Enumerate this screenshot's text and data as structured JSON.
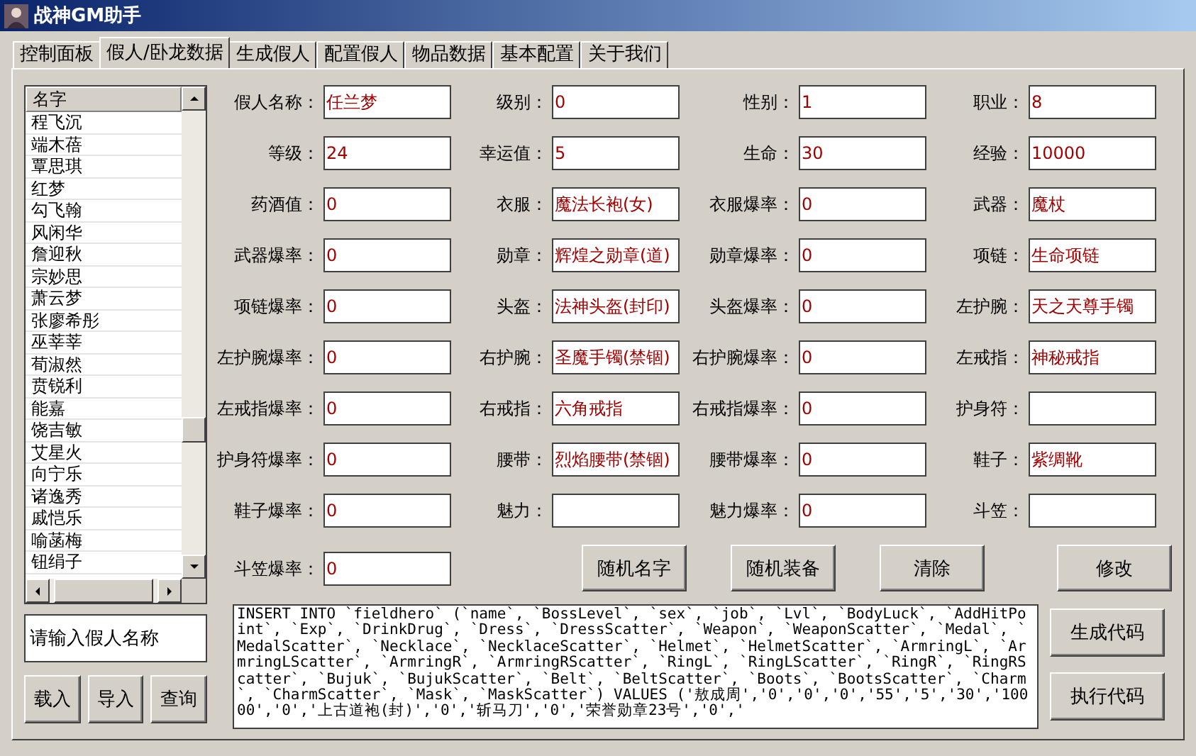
{
  "window": {
    "title": "战神GM助手"
  },
  "tabs": [
    {
      "label": "控制面板",
      "selected": false
    },
    {
      "label": "假人/卧龙数据",
      "selected": true
    },
    {
      "label": "生成假人",
      "selected": false
    },
    {
      "label": "配置假人",
      "selected": false
    },
    {
      "label": "物品数据",
      "selected": false
    },
    {
      "label": "基本配置",
      "selected": false
    },
    {
      "label": "关于我们",
      "selected": false
    }
  ],
  "name_list": {
    "header": "名字",
    "items": [
      "程飞沉",
      "端木蓓",
      "覃思琪",
      "红梦",
      "勾飞翰",
      "风闲华",
      "詹迎秋",
      "宗妙思",
      "萧云梦",
      "张廖希彤",
      "巫莘莘",
      "荀淑然",
      "贲锐利",
      "能嘉",
      "饶吉敏",
      "艾星火",
      "向宁乐",
      "诸逸秀",
      "戚恺乐",
      "喻菡梅",
      "钮绢子"
    ]
  },
  "name_input": {
    "placeholder": "请输入假人名称"
  },
  "left_buttons": [
    "载入",
    "导入",
    "查询"
  ],
  "fields": [
    {
      "label": "假人名称：",
      "value": "任兰梦"
    },
    {
      "label": "级别：",
      "value": "0"
    },
    {
      "label": "性别：",
      "value": "1"
    },
    {
      "label": "职业：",
      "value": "8"
    },
    {
      "label": "等级：",
      "value": "24"
    },
    {
      "label": "幸运值：",
      "value": "5"
    },
    {
      "label": "生命：",
      "value": "30"
    },
    {
      "label": "经验：",
      "value": "10000"
    },
    {
      "label": "药酒值：",
      "value": "0"
    },
    {
      "label": "衣服：",
      "value": "魔法长袍(女)"
    },
    {
      "label": "衣服爆率：",
      "value": "0"
    },
    {
      "label": "武器：",
      "value": "魔杖"
    },
    {
      "label": "武器爆率：",
      "value": "0"
    },
    {
      "label": "勋章：",
      "value": "辉煌之勋章(道)"
    },
    {
      "label": "勋章爆率：",
      "value": "0"
    },
    {
      "label": "项链：",
      "value": "生命项链"
    },
    {
      "label": "项链爆率：",
      "value": "0"
    },
    {
      "label": "头盔：",
      "value": "法神头盔(封印)"
    },
    {
      "label": "头盔爆率：",
      "value": "0"
    },
    {
      "label": "左护腕：",
      "value": "天之天尊手镯"
    },
    {
      "label": "左护腕爆率：",
      "value": "0"
    },
    {
      "label": "右护腕：",
      "value": "圣魔手镯(禁锢)"
    },
    {
      "label": "右护腕爆率：",
      "value": "0"
    },
    {
      "label": "左戒指：",
      "value": "神秘戒指"
    },
    {
      "label": "左戒指爆率：",
      "value": "0"
    },
    {
      "label": "右戒指：",
      "value": "六角戒指"
    },
    {
      "label": "右戒指爆率：",
      "value": "0"
    },
    {
      "label": "护身符："
    },
    {
      "label": "护身符爆率：",
      "value": "0"
    },
    {
      "label": "腰带：",
      "value": "烈焰腰带(禁锢)"
    },
    {
      "label": "腰带爆率：",
      "value": "0"
    },
    {
      "label": "鞋子：",
      "value": "紫绸靴"
    },
    {
      "label": "鞋子爆率：",
      "value": "0"
    },
    {
      "label": "魅力："
    },
    {
      "label": "魅力爆率：",
      "value": "0"
    },
    {
      "label": "斗笠："
    },
    {
      "label": "斗笠爆率：",
      "value": "0"
    }
  ],
  "action_buttons": [
    "随机名字",
    "随机装备",
    "清除",
    "修改"
  ],
  "sql_code": "INSERT INTO `fieldhero` (`name`, `BossLevel`, `sex`, `job`, `Lvl`, `BodyLuck`, `AddHitPoint`, `Exp`, `DrinkDrug`, `Dress`, `DressScatter`, `Weapon`, `WeaponScatter`, `Medal`, `MedalScatter`, `Necklace`, `NecklaceScatter`, `Helmet`, `HelmetScatter`, `ArmringL`, `ArmringLScatter`, `ArmringR`, `ArmringRScatter`, `RingL`, `RingLScatter`, `RingR`, `RingRScatter`, `Bujuk`, `BujukScatter`, `Belt`, `BeltScatter`, `Boots`, `BootsScatter`, `Charm`, `CharmScatter`, `Mask`, `MaskScatter`) VALUES ('敖成周','0','0','0','55','5','30','10000','0','上古道袍(封)','0','斩马刀','0','荣誉勋章23号','0','",
  "code_buttons": [
    "生成代码",
    "执行代码"
  ]
}
